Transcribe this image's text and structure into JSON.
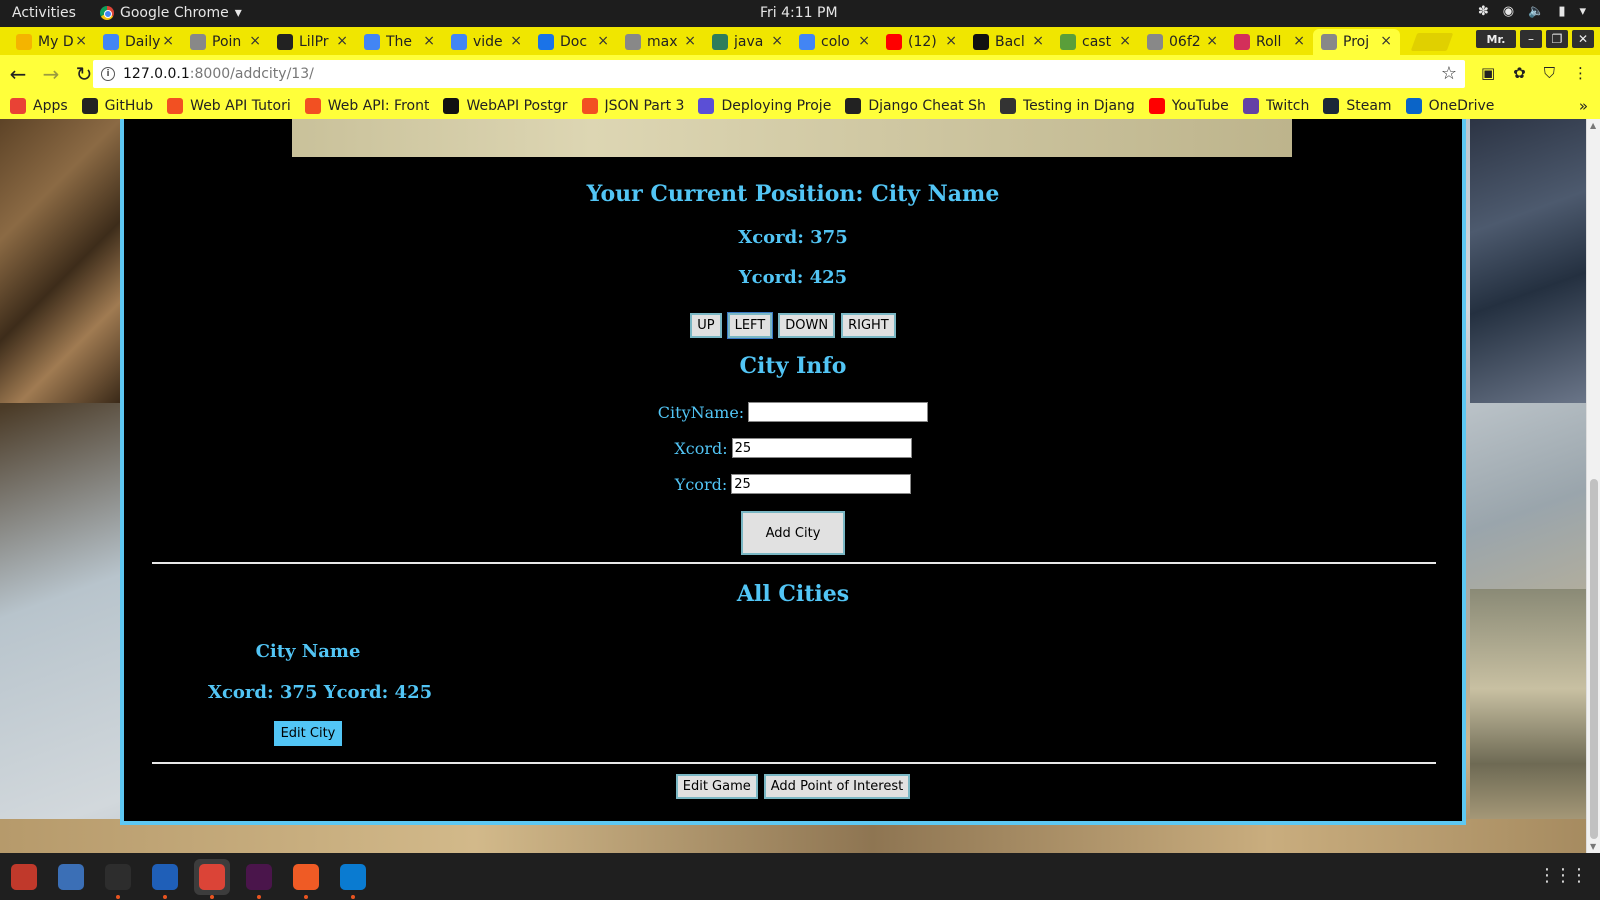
{
  "system": {
    "activities": "Activities",
    "app_name": "Google Chrome",
    "clock": "Fri  4:11 PM"
  },
  "tabs": [
    {
      "title": "My D",
      "icon": "google-drive-icon",
      "color": "#f4b400"
    },
    {
      "title": "Daily",
      "icon": "docs-icon",
      "color": "#4285f4"
    },
    {
      "title": "Poin",
      "icon": "document-icon",
      "color": "#888888"
    },
    {
      "title": "LilPr",
      "icon": "github-icon",
      "color": "#222222"
    },
    {
      "title": "The",
      "icon": "google-icon",
      "color": "#4285f4"
    },
    {
      "title": "vide",
      "icon": "google-icon",
      "color": "#4285f4"
    },
    {
      "title": "Doc",
      "icon": "docs-icon",
      "color": "#1a73e8"
    },
    {
      "title": "max",
      "icon": "document-icon",
      "color": "#888888"
    },
    {
      "title": "java",
      "icon": "cloud-icon",
      "color": "#2e7d5b"
    },
    {
      "title": "colo",
      "icon": "google-icon",
      "color": "#4285f4"
    },
    {
      "title": "(12)",
      "icon": "youtube-icon",
      "color": "#ff0000"
    },
    {
      "title": "Bacl",
      "icon": "b-icon",
      "color": "#111111"
    },
    {
      "title": "cast",
      "icon": "leaf-icon",
      "color": "#5a9e3a"
    },
    {
      "title": "06f2",
      "icon": "document-icon",
      "color": "#888888"
    },
    {
      "title": "Roll",
      "icon": "dice-icon",
      "color": "#d32f5a"
    },
    {
      "title": "Proj",
      "icon": "document-icon",
      "color": "#888888",
      "active": true
    }
  ],
  "window": {
    "profile": "Mr."
  },
  "address_bar": {
    "host": "127.0.0.1",
    "path": ":8000/addcity/13/"
  },
  "bookmarks": [
    {
      "label": "Apps",
      "icon": "apps-grid-icon",
      "color": "#e94235"
    },
    {
      "label": "GitHub",
      "icon": "github-icon",
      "color": "#222222"
    },
    {
      "label": "Web API Tutori",
      "icon": "microsoft-icon",
      "color": "#f25022"
    },
    {
      "label": "Web API: Front",
      "icon": "microsoft-icon",
      "color": "#f25022"
    },
    {
      "label": "WebAPI Postgr",
      "icon": "medium-icon",
      "color": "#111111"
    },
    {
      "label": "JSON Part 3",
      "icon": "microsoft-icon",
      "color": "#f25022"
    },
    {
      "label": "Deploying Proje",
      "icon": "docs-icon",
      "color": "#5b4fd6"
    },
    {
      "label": "Django Cheat Sh",
      "icon": "github-icon",
      "color": "#222222"
    },
    {
      "label": "Testing in Djang",
      "icon": "gear-icon",
      "color": "#333333"
    },
    {
      "label": "YouTube",
      "icon": "youtube-icon",
      "color": "#ff0000"
    },
    {
      "label": "Twitch",
      "icon": "twitch-icon",
      "color": "#6441a5"
    },
    {
      "label": "Steam",
      "icon": "steam-icon",
      "color": "#1b2838"
    },
    {
      "label": "OneDrive",
      "icon": "onedrive-icon",
      "color": "#0a64c8"
    }
  ],
  "page": {
    "position_title": "Your Current Position: City Name",
    "position_x": "Xcord: 375",
    "position_y": "Ycord: 425",
    "move_buttons": [
      "UP",
      "LEFT",
      "DOWN",
      "RIGHT"
    ],
    "city_info_title": "City Info",
    "form": {
      "name_label": "CityName:",
      "name_value": "",
      "x_label": "Xcord:",
      "x_value": "25",
      "y_label": "Ycord:",
      "y_value": "25",
      "submit_label": "Add City"
    },
    "all_cities_title": "All Cities",
    "cities": [
      {
        "name": "City Name",
        "coords": "Xcord: 375 Ycord: 425",
        "edit_label": "Edit City"
      }
    ],
    "bottom_buttons": [
      "Edit Game",
      "Add Point of Interest"
    ]
  },
  "colors": {
    "accent": "#52c5f5",
    "tab_strip": "#f0e600",
    "toolbar": "#ffff3a",
    "panel_background": "#000000"
  },
  "dock": [
    {
      "name": "files-icon",
      "color": "#c0392b"
    },
    {
      "name": "help-icon",
      "color": "#3b6fb6"
    },
    {
      "name": "terminal-icon",
      "color": "#2d2d2d"
    },
    {
      "name": "intellij-icon",
      "color": "#1f5fb8"
    },
    {
      "name": "chrome-icon",
      "color": "#db4437",
      "active": true
    },
    {
      "name": "slack-icon",
      "color": "#4a154b"
    },
    {
      "name": "postman-icon",
      "color": "#ef5b25"
    },
    {
      "name": "vscode-icon",
      "color": "#0a7bd1"
    }
  ]
}
